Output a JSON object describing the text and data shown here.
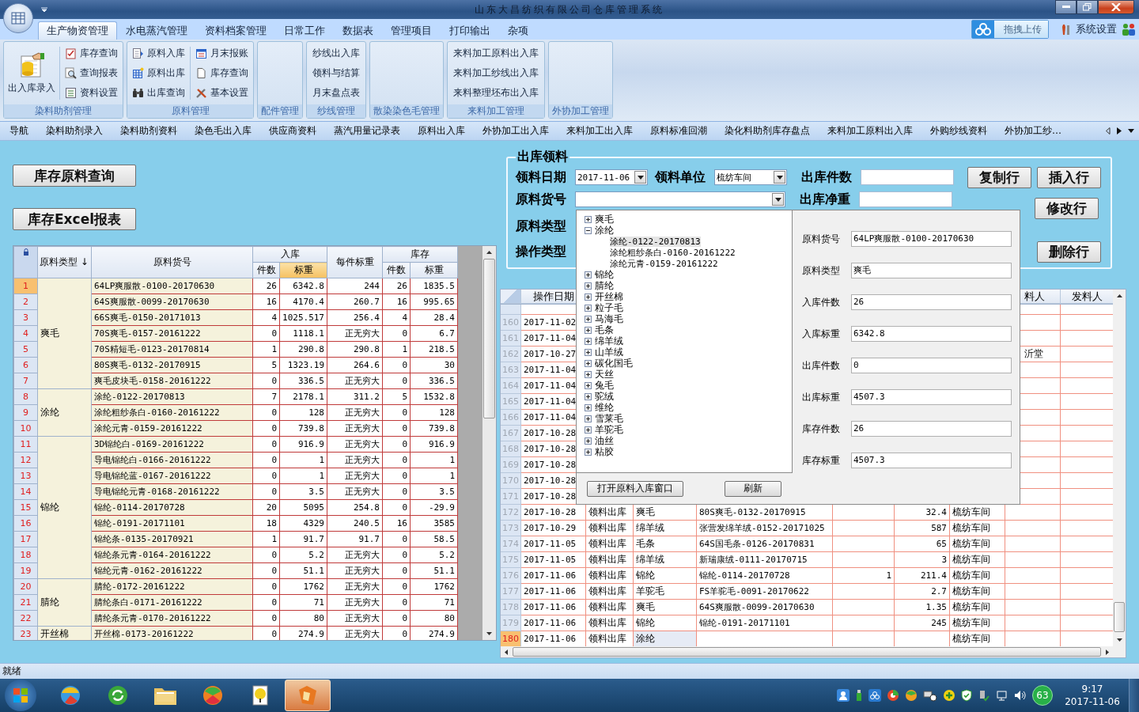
{
  "window": {
    "title": "山东大昌纺织有限公司仓库管理系统"
  },
  "tabs": [
    {
      "label": "生产物资管理",
      "selected": true
    },
    {
      "label": "水电蒸汽管理",
      "selected": false
    },
    {
      "label": "资料档案管理",
      "selected": false
    },
    {
      "label": "日常工作",
      "selected": false
    },
    {
      "label": "数据表",
      "selected": false
    },
    {
      "label": "管理项目",
      "selected": false
    },
    {
      "label": "打印输出",
      "selected": false
    },
    {
      "label": "杂项",
      "selected": false
    }
  ],
  "upload_widget": {
    "label": "拖拽上传"
  },
  "settings_link": {
    "label": "系统设置"
  },
  "ribbon": {
    "groups": [
      {
        "title": "染料助剂管理",
        "kind": "icons",
        "large": {
          "label": "出入库录入"
        },
        "items": [
          {
            "label": "库存查询"
          },
          {
            "label": "查询报表"
          },
          {
            "label": "资料设置"
          }
        ]
      },
      {
        "title": "原料管理",
        "kind": "icons",
        "items": [
          {
            "label": "原料入库"
          },
          {
            "label": "原料出库"
          },
          {
            "label": "出库查询"
          },
          {
            "label": "月末报账"
          },
          {
            "label": "库存查询"
          },
          {
            "label": "基本设置"
          }
        ]
      },
      {
        "title": "配件管理",
        "kind": "empty"
      },
      {
        "title": "纱线管理",
        "kind": "text",
        "items": [
          {
            "label": "纱线出入库"
          },
          {
            "label": "领料与结算"
          },
          {
            "label": "月末盘点表"
          }
        ]
      },
      {
        "title": "散染染色毛管理",
        "kind": "empty"
      },
      {
        "title": "来料加工管理",
        "kind": "text",
        "items": [
          {
            "label": "来料加工原料出入库"
          },
          {
            "label": "来料加工纱线出入库"
          },
          {
            "label": "来料整理坯布出入库"
          }
        ]
      },
      {
        "title": "外协加工管理",
        "kind": "empty"
      }
    ]
  },
  "quick_nav": {
    "items": [
      "导航",
      "染料助剂录入",
      "染料助剂资料",
      "染色毛出入库",
      "供应商资料",
      "蒸汽用量记录表",
      "原料出入库",
      "外协加工出入库",
      "来料加工出入库",
      "原料标准回潮",
      "染化料助剂库存盘点",
      "来料加工原料出入库",
      "外购纱线资料",
      "外协加工纱…"
    ]
  },
  "left_buttons": [
    "库存原料查询",
    "库存Excel报表"
  ],
  "stock_table": {
    "type_header": "原料类型 ↓",
    "code_header": "原料货号",
    "in_header": "入库",
    "in_pieces": "件数",
    "in_weight": {
      "label": "标重",
      "selected": true
    },
    "per_header": "每件标重",
    "stock_header": "库存",
    "stock_pieces": "件数",
    "stock_weight": {
      "label": "标重",
      "selected": false
    },
    "groups": [
      {
        "type": "爽毛",
        "rows": [
          {
            "n": "1",
            "code": "64LP爽服散-0100-20170630",
            "in_pcs": "26",
            "in_wt": "6342.8",
            "per": "244",
            "st_pcs": "26",
            "st_wt": "1835.5",
            "selected": true
          },
          {
            "n": "2",
            "code": "64S爽服散-0099-20170630",
            "in_pcs": "16",
            "in_wt": "4170.4",
            "per": "260.7",
            "st_pcs": "16",
            "st_wt": "995.65",
            "selected": false
          },
          {
            "n": "3",
            "code": "66S爽毛-0150-20171013",
            "in_pcs": "4",
            "in_wt": "1025.517",
            "per": "256.4",
            "st_pcs": "4",
            "st_wt": "28.4",
            "selected": false
          },
          {
            "n": "4",
            "code": "70S爽毛-0157-20161222",
            "in_pcs": "0",
            "in_wt": "1118.1",
            "per": "正无穷大",
            "st_pcs": "0",
            "st_wt": "6.7",
            "selected": false
          },
          {
            "n": "5",
            "code": "70S精短毛-0123-20170814",
            "in_pcs": "1",
            "in_wt": "290.8",
            "per": "290.8",
            "st_pcs": "1",
            "st_wt": "218.5",
            "selected": false
          },
          {
            "n": "6",
            "code": "80S爽毛-0132-20170915",
            "in_pcs": "5",
            "in_wt": "1323.19",
            "per": "264.6",
            "st_pcs": "0",
            "st_wt": "30",
            "selected": false
          },
          {
            "n": "7",
            "code": "爽毛皮块毛-0158-20161222",
            "in_pcs": "0",
            "in_wt": "336.5",
            "per": "正无穷大",
            "st_pcs": "0",
            "st_wt": "336.5",
            "selected": false
          }
        ]
      },
      {
        "type": "涂纶",
        "rows": [
          {
            "n": "8",
            "code": "涂纶-0122-20170813",
            "in_pcs": "7",
            "in_wt": "2178.1",
            "per": "311.2",
            "st_pcs": "5",
            "st_wt": "1532.8",
            "selected": false
          },
          {
            "n": "9",
            "code": "涂纶粗纱条白-0160-20161222",
            "in_pcs": "0",
            "in_wt": "128",
            "per": "正无穷大",
            "st_pcs": "0",
            "st_wt": "128",
            "selected": false
          },
          {
            "n": "10",
            "code": "涂纶元青-0159-20161222",
            "in_pcs": "0",
            "in_wt": "739.8",
            "per": "正无穷大",
            "st_pcs": "0",
            "st_wt": "739.8",
            "selected": false
          }
        ]
      },
      {
        "type": "锦纶",
        "rows": [
          {
            "n": "11",
            "code": "3D锦纶白-0169-20161222",
            "in_pcs": "0",
            "in_wt": "916.9",
            "per": "正无穷大",
            "st_pcs": "0",
            "st_wt": "916.9",
            "selected": false
          },
          {
            "n": "12",
            "code": "导电锦纶白-0166-20161222",
            "in_pcs": "0",
            "in_wt": "1",
            "per": "正无穷大",
            "st_pcs": "0",
            "st_wt": "1",
            "selected": false
          },
          {
            "n": "13",
            "code": "导电锦纶蓝-0167-20161222",
            "in_pcs": "0",
            "in_wt": "1",
            "per": "正无穷大",
            "st_pcs": "0",
            "st_wt": "1",
            "selected": false
          },
          {
            "n": "14",
            "code": "导电锦纶元青-0168-20161222",
            "in_pcs": "0",
            "in_wt": "3.5",
            "per": "正无穷大",
            "st_pcs": "0",
            "st_wt": "3.5",
            "selected": false
          },
          {
            "n": "15",
            "code": "锦纶-0114-20170728",
            "in_pcs": "20",
            "in_wt": "5095",
            "per": "254.8",
            "st_pcs": "0",
            "st_wt": "-29.9",
            "selected": false
          },
          {
            "n": "16",
            "code": "锦纶-0191-20171101",
            "in_pcs": "18",
            "in_wt": "4329",
            "per": "240.5",
            "st_pcs": "16",
            "st_wt": "3585",
            "selected": false
          },
          {
            "n": "17",
            "code": "锦纶条-0135-20170921",
            "in_pcs": "1",
            "in_wt": "91.7",
            "per": "91.7",
            "st_pcs": "0",
            "st_wt": "58.5",
            "selected": false
          },
          {
            "n": "18",
            "code": "锦纶条元青-0164-20161222",
            "in_pcs": "0",
            "in_wt": "5.2",
            "per": "正无穷大",
            "st_pcs": "0",
            "st_wt": "5.2",
            "selected": false
          },
          {
            "n": "19",
            "code": "锦纶元青-0162-20161222",
            "in_pcs": "0",
            "in_wt": "51.1",
            "per": "正无穷大",
            "st_pcs": "0",
            "st_wt": "51.1",
            "selected": false
          }
        ]
      },
      {
        "type": "腈纶",
        "rows": [
          {
            "n": "20",
            "code": "腈纶-0172-20161222",
            "in_pcs": "0",
            "in_wt": "1762",
            "per": "正无穷大",
            "st_pcs": "0",
            "st_wt": "1762",
            "selected": false
          },
          {
            "n": "21",
            "code": "腈纶条白-0171-20161222",
            "in_pcs": "0",
            "in_wt": "71",
            "per": "正无穷大",
            "st_pcs": "0",
            "st_wt": "71",
            "selected": false
          },
          {
            "n": "22",
            "code": "腈纶条元青-0170-20161222",
            "in_pcs": "0",
            "in_wt": "80",
            "per": "正无穷大",
            "st_pcs": "0",
            "st_wt": "80",
            "selected": false
          }
        ]
      },
      {
        "type": "开丝棉",
        "rows": [
          {
            "n": "23",
            "code": "开丝棉-0173-20161222",
            "in_pcs": "0",
            "in_wt": "274.9",
            "per": "正无穷大",
            "st_pcs": "0",
            "st_wt": "274.9",
            "selected": false
          }
        ]
      }
    ]
  },
  "issue_form": {
    "legend": "出库领料",
    "date_label": "领料日期",
    "date_value": "2017-11-06",
    "unit_label": "领料单位",
    "unit_value": "梳纺车间",
    "out_pieces_label": "出库件数",
    "code_label": "原料货号",
    "net_weight_label": "出库净重",
    "type_label": "原料类型",
    "op_label": "操作类型",
    "buttons": [
      "复制行",
      "插入行",
      "修改行",
      "删除行"
    ]
  },
  "material_dropdown": {
    "tree": [
      {
        "label": "爽毛",
        "expanded": false
      },
      {
        "label": "涂纶",
        "expanded": true,
        "children": [
          {
            "label": "涂纶-0122-20170813",
            "selected": true
          },
          {
            "label": "涂纶粗纱条白-0160-20161222",
            "selected": false
          },
          {
            "label": "涂纶元青-0159-20161222",
            "selected": false
          }
        ]
      },
      {
        "label": "锦纶",
        "expanded": false
      },
      {
        "label": "腈纶",
        "expanded": false
      },
      {
        "label": "开丝棉",
        "expanded": false
      },
      {
        "label": "粒子毛",
        "expanded": false
      },
      {
        "label": "马海毛",
        "expanded": false
      },
      {
        "label": "毛条",
        "expanded": false
      },
      {
        "label": "绵羊绒",
        "expanded": false
      },
      {
        "label": "山羊绒",
        "expanded": false
      },
      {
        "label": "碳化国毛",
        "expanded": false
      },
      {
        "label": "天丝",
        "expanded": false
      },
      {
        "label": "兔毛",
        "expanded": false
      },
      {
        "label": "驼绒",
        "expanded": false
      },
      {
        "label": "维纶",
        "expanded": false
      },
      {
        "label": "雪莱毛",
        "expanded": false
      },
      {
        "label": "羊驼毛",
        "expanded": false
      },
      {
        "label": "油丝",
        "expanded": false
      },
      {
        "label": "粘胶",
        "expanded": false
      }
    ],
    "details": [
      {
        "label": "原料货号",
        "value": "64LP爽服散-0100-20170630"
      },
      {
        "label": "原料类型",
        "value": "爽毛"
      },
      {
        "label": "入库件数",
        "value": "26"
      },
      {
        "label": "入库标重",
        "value": "6342.8"
      },
      {
        "label": "出库件数",
        "value": "0"
      },
      {
        "label": "出库标重",
        "value": "4507.3"
      },
      {
        "label": "库存件数",
        "value": "26"
      },
      {
        "label": "库存标重",
        "value": "4507.3"
      }
    ],
    "buttons": [
      "打开原料入库窗口",
      "刷新"
    ]
  },
  "issue_grid": {
    "headers": {
      "date": "操作日期",
      "person": "料人",
      "sender": "发料人"
    },
    "rows": [
      {
        "n": "160",
        "date": "2017-11-02",
        "selected": false
      },
      {
        "n": "161",
        "date": "2017-11-04",
        "selected": false
      },
      {
        "n": "162",
        "date": "2017-10-27",
        "person": "沂堂",
        "selected": false
      },
      {
        "n": "163",
        "date": "2017-11-04",
        "selected": false
      },
      {
        "n": "164",
        "date": "2017-11-04",
        "selected": false
      },
      {
        "n": "165",
        "date": "2017-11-04",
        "selected": false
      },
      {
        "n": "166",
        "date": "2017-11-04",
        "selected": false
      },
      {
        "n": "167",
        "date": "2017-10-28",
        "selected": false
      },
      {
        "n": "168",
        "date": "2017-10-28",
        "selected": false
      },
      {
        "n": "169",
        "date": "2017-10-28",
        "selected": false
      },
      {
        "n": "170",
        "date": "2017-10-28",
        "selected": false
      },
      {
        "n": "171",
        "date": "2017-10-28",
        "selected": false
      },
      {
        "n": "172",
        "date": "2017-10-28",
        "op": "领料出库",
        "type": "爽毛",
        "code": "80S爽毛-0132-20170915",
        "wt": "32.4",
        "unit": "梳纺车间",
        "selected": false
      },
      {
        "n": "173",
        "date": "2017-10-29",
        "op": "领料出库",
        "type": "绵羊绒",
        "code": "张营发绵羊绒-0152-20171025",
        "wt": "587",
        "unit": "梳纺车间",
        "selected": false
      },
      {
        "n": "174",
        "date": "2017-11-05",
        "op": "领料出库",
        "type": "毛条",
        "code": "64S国毛条-0126-20170831",
        "wt": "65",
        "unit": "梳纺车间",
        "selected": false
      },
      {
        "n": "175",
        "date": "2017-11-05",
        "op": "领料出库",
        "type": "绵羊绒",
        "code": "新瑞康绒-0111-20170715",
        "wt": "3",
        "unit": "梳纺车间",
        "selected": false
      },
      {
        "n": "176",
        "date": "2017-11-06",
        "op": "领料出库",
        "type": "锦纶",
        "code": "锦纶-0114-20170728",
        "pcs": "1",
        "wt": "211.4",
        "unit": "梳纺车间",
        "selected": false
      },
      {
        "n": "177",
        "date": "2017-11-06",
        "op": "领料出库",
        "type": "羊驼毛",
        "code": "FS羊驼毛-0091-20170622",
        "wt": "2.7",
        "unit": "梳纺车间",
        "selected": false
      },
      {
        "n": "178",
        "date": "2017-11-06",
        "op": "领料出库",
        "type": "爽毛",
        "code": "64S爽服散-0099-20170630",
        "wt": "1.35",
        "unit": "梳纺车间",
        "selected": false
      },
      {
        "n": "179",
        "date": "2017-11-06",
        "op": "领料出库",
        "type": "锦纶",
        "code": "锦纶-0191-20171101",
        "wt": "245",
        "unit": "梳纺车间",
        "selected": false
      },
      {
        "n": "180",
        "date": "2017-11-06",
        "op": "领料出库",
        "type": "涂纶",
        "unit": "梳纺车间",
        "selected": true
      }
    ]
  },
  "status_bar": {
    "text": "就绪"
  },
  "taskbar": {
    "badge": "63",
    "time": "9:17",
    "date": "2017-11-06"
  }
}
